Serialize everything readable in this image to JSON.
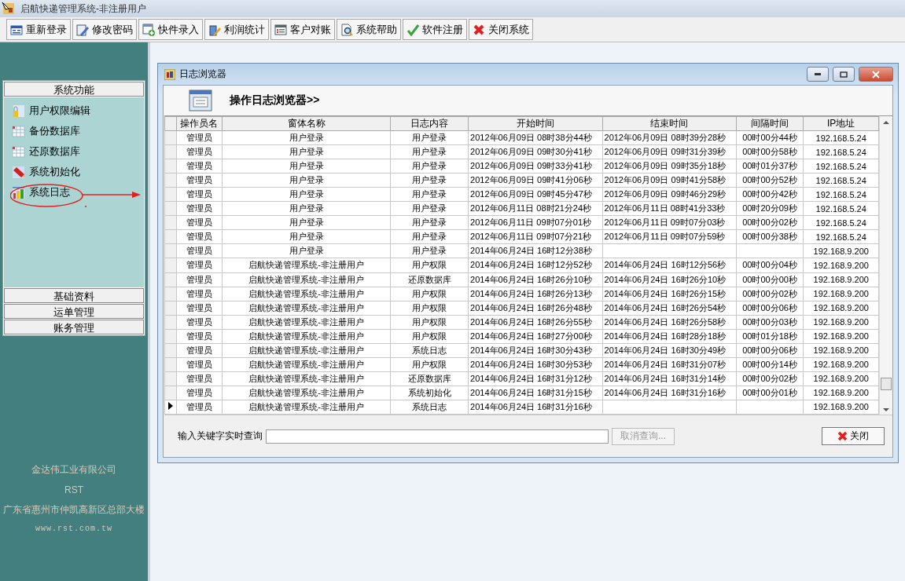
{
  "window": {
    "title": "启航快递管理系统-非注册用户"
  },
  "toolbar": [
    "重新登录",
    "修改密码",
    "快件录入",
    "利润统计",
    "客户对账",
    "系统帮助",
    "软件注册",
    "关闭系统"
  ],
  "sidebar": {
    "sections": [
      {
        "label": "系统功能",
        "items": [
          "用户权限编辑",
          "备份数据库",
          "还原数据库",
          "系统初始化",
          "系统日志"
        ]
      },
      {
        "label": "基础资料"
      },
      {
        "label": "运单管理"
      },
      {
        "label": "账务管理"
      }
    ],
    "footer": [
      "金达伟工业有限公司",
      "RST",
      "广东省惠州市仲凯高新区总部大楼",
      "www.rst.com.tw"
    ]
  },
  "log_window": {
    "title": "日志浏览器",
    "heading": "操作日志浏览器>>",
    "table": {
      "columns": [
        "操作员名",
        "窗体名称",
        "日志内容",
        "开始时间",
        "结束时间",
        "间隔时间",
        "IP地址"
      ],
      "rows": [
        {
          "selected": false,
          "cells": [
            "管理员",
            "用户登录",
            "用户登录",
            "2012年06月09日  08时38分44秒",
            "2012年06月09日  08时39分28秒",
            "00时00分44秒",
            "192.168.5.24"
          ]
        },
        {
          "selected": false,
          "cells": [
            "管理员",
            "用户登录",
            "用户登录",
            "2012年06月09日  09时30分41秒",
            "2012年06月09日  09时31分39秒",
            "00时00分58秒",
            "192.168.5.24"
          ]
        },
        {
          "selected": false,
          "cells": [
            "管理员",
            "用户登录",
            "用户登录",
            "2012年06月09日  09时33分41秒",
            "2012年06月09日  09时35分18秒",
            "00时01分37秒",
            "192.168.5.24"
          ]
        },
        {
          "selected": false,
          "cells": [
            "管理员",
            "用户登录",
            "用户登录",
            "2012年06月09日  09时41分06秒",
            "2012年06月09日  09时41分58秒",
            "00时00分52秒",
            "192.168.5.24"
          ]
        },
        {
          "selected": false,
          "cells": [
            "管理员",
            "用户登录",
            "用户登录",
            "2012年06月09日  09时45分47秒",
            "2012年06月09日  09时46分29秒",
            "00时00分42秒",
            "192.168.5.24"
          ]
        },
        {
          "selected": false,
          "cells": [
            "管理员",
            "用户登录",
            "用户登录",
            "2012年06月11日  08时21分24秒",
            "2012年06月11日  08时41分33秒",
            "00时20分09秒",
            "192.168.5.24"
          ]
        },
        {
          "selected": false,
          "cells": [
            "管理员",
            "用户登录",
            "用户登录",
            "2012年06月11日  09时07分01秒",
            "2012年06月11日  09时07分03秒",
            "00时00分02秒",
            "192.168.5.24"
          ]
        },
        {
          "selected": false,
          "cells": [
            "管理员",
            "用户登录",
            "用户登录",
            "2012年06月11日  09时07分21秒",
            "2012年06月11日  09时07分59秒",
            "00时00分38秒",
            "192.168.5.24"
          ]
        },
        {
          "selected": false,
          "cells": [
            "管理员",
            "用户登录",
            "用户登录",
            "2014年06月24日  16时12分38秒",
            "",
            "",
            "192.168.9.200"
          ]
        },
        {
          "selected": false,
          "cells": [
            "管理员",
            "启航快递管理系统-非注册用户",
            "用户权限",
            "2014年06月24日  16时12分52秒",
            "2014年06月24日  16时12分56秒",
            "00时00分04秒",
            "192.168.9.200"
          ]
        },
        {
          "selected": false,
          "cells": [
            "管理员",
            "启航快递管理系统-非注册用户",
            "还原数据库",
            "2014年06月24日  16时26分10秒",
            "2014年06月24日  16时26分10秒",
            "00时00分00秒",
            "192.168.9.200"
          ]
        },
        {
          "selected": false,
          "cells": [
            "管理员",
            "启航快递管理系统-非注册用户",
            "用户权限",
            "2014年06月24日  16时26分13秒",
            "2014年06月24日  16时26分15秒",
            "00时00分02秒",
            "192.168.9.200"
          ]
        },
        {
          "selected": false,
          "cells": [
            "管理员",
            "启航快递管理系统-非注册用户",
            "用户权限",
            "2014年06月24日  16时26分48秒",
            "2014年06月24日  16时26分54秒",
            "00时00分06秒",
            "192.168.9.200"
          ]
        },
        {
          "selected": false,
          "cells": [
            "管理员",
            "启航快递管理系统-非注册用户",
            "用户权限",
            "2014年06月24日  16时26分55秒",
            "2014年06月24日  16时26分58秒",
            "00时00分03秒",
            "192.168.9.200"
          ]
        },
        {
          "selected": false,
          "cells": [
            "管理员",
            "启航快递管理系统-非注册用户",
            "用户权限",
            "2014年06月24日  16时27分00秒",
            "2014年06月24日  16时28分18秒",
            "00时01分18秒",
            "192.168.9.200"
          ]
        },
        {
          "selected": false,
          "cells": [
            "管理员",
            "启航快递管理系统-非注册用户",
            "系统日志",
            "2014年06月24日  16时30分43秒",
            "2014年06月24日  16时30分49秒",
            "00时00分06秒",
            "192.168.9.200"
          ]
        },
        {
          "selected": false,
          "cells": [
            "管理员",
            "启航快递管理系统-非注册用户",
            "用户权限",
            "2014年06月24日  16时30分53秒",
            "2014年06月24日  16时31分07秒",
            "00时00分14秒",
            "192.168.9.200"
          ]
        },
        {
          "selected": false,
          "cells": [
            "管理员",
            "启航快递管理系统-非注册用户",
            "还原数据库",
            "2014年06月24日  16时31分12秒",
            "2014年06月24日  16时31分14秒",
            "00时00分02秒",
            "192.168.9.200"
          ]
        },
        {
          "selected": false,
          "cells": [
            "管理员",
            "启航快递管理系统-非注册用户",
            "系统初始化",
            "2014年06月24日  16时31分15秒",
            "2014年06月24日  16时31分16秒",
            "00时00分01秒",
            "192.168.9.200"
          ]
        },
        {
          "selected": true,
          "cells": [
            "管理员",
            "启航快递管理系统-非注册用户",
            "系统日志",
            "2014年06月24日  16时31分16秒",
            "",
            "",
            "192.168.9.200"
          ]
        }
      ]
    },
    "search": {
      "label": "输入关键字实时查询"
    },
    "cancel_button": {
      "label": "取消查询...",
      "disabled": true
    },
    "close_button": {
      "label": "关闭"
    }
  }
}
